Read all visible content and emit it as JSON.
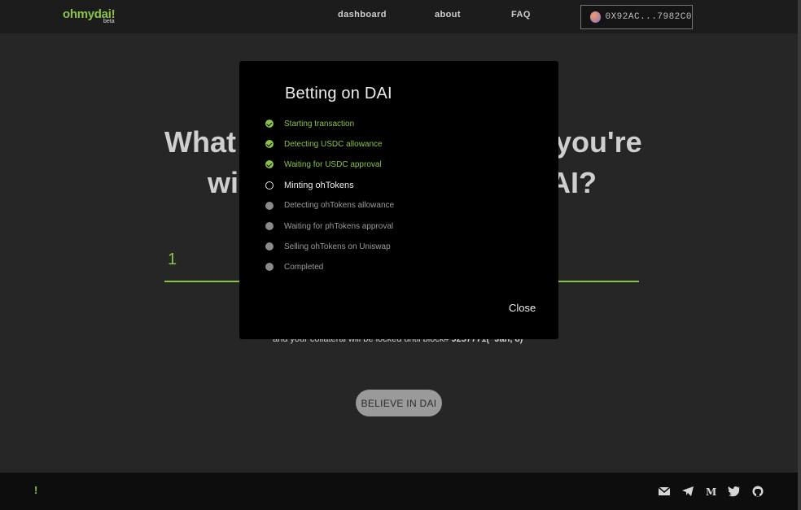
{
  "nav": {
    "logo": "ohmydai!",
    "logo_badge": "beta",
    "links": [
      "dashboard",
      "about",
      "FAQ"
    ],
    "wallet_address": "0X92AC...7982C0"
  },
  "hero": {
    "line1_left": "What i",
    "line1_right": "you're",
    "line2_left": "wi",
    "line2_right": "AI?"
  },
  "bet_form": {
    "amount": "1",
    "lock_note_prefix": "and your collateral will be locked until block#",
    "lock_block": "9257771(~Jan, 8)",
    "submit_label": "BELIEVE IN DAI"
  },
  "modal": {
    "title": "Betting on DAI",
    "steps": [
      {
        "label": "Starting transaction",
        "status": "done"
      },
      {
        "label": "Detecting USDC allowance",
        "status": "done"
      },
      {
        "label": "Waiting for USDC approval",
        "status": "done"
      },
      {
        "label": "Minting ohTokens",
        "status": "active"
      },
      {
        "label": "Detecting ohTokens allowance",
        "status": "pending"
      },
      {
        "label": "Waiting for phTokens approval",
        "status": "pending"
      },
      {
        "label": "Selling ohTokens on Uniswap",
        "status": "pending"
      },
      {
        "label": "Completed",
        "status": "pending"
      }
    ],
    "close_label": "Close"
  },
  "footer": {
    "logo": "!",
    "icons": [
      "mail-icon",
      "telegram-icon",
      "medium-icon",
      "twitter-icon",
      "github-icon"
    ]
  },
  "colors": {
    "accent": "#8bc34a",
    "background": "#262626",
    "modal_background": "#000000"
  }
}
